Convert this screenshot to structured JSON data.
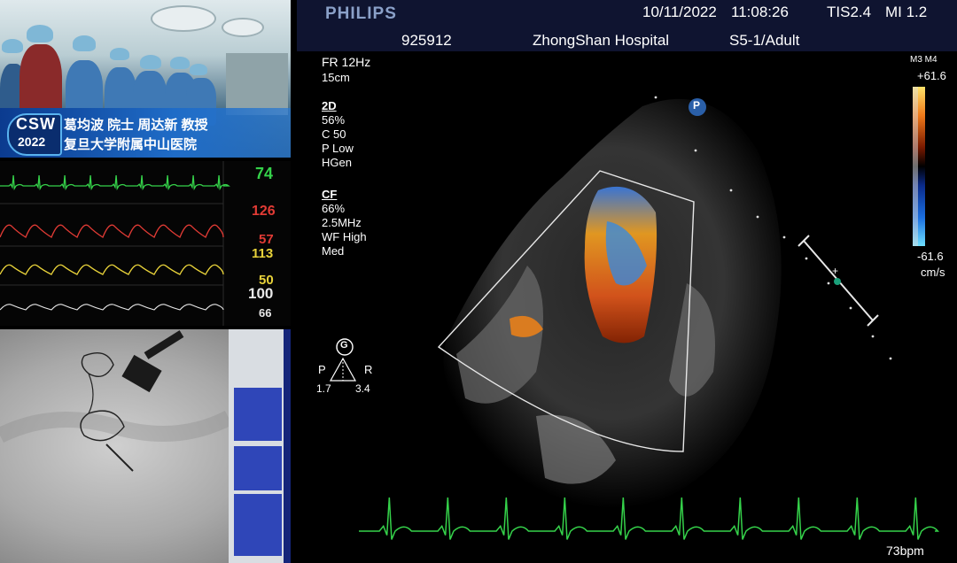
{
  "broadcast": {
    "logo_text": "CSW",
    "logo_year": "2022",
    "speaker_line": "葛均波 院士 周达新 教授",
    "hospital_line": "复旦大学附属中山医院"
  },
  "monitor": {
    "hr": "74",
    "art_sys": "126",
    "art_dia": "57",
    "lv_sys": "113",
    "lv_dia": "50",
    "spo2": "100",
    "resp": "66",
    "colors": {
      "ecg": "#35d24a",
      "art": "#e23b35",
      "lv": "#e8d23a",
      "spo2": "#e8e8e8"
    }
  },
  "echo": {
    "brand": "PHILIPS",
    "date": "10/11/2022",
    "time": "11:08:26",
    "tis": "TIS2.4",
    "mi": "MI 1.2",
    "patient_id": "925912",
    "hospital": "ZhongShan Hospital",
    "probe": "S5-1/Adult",
    "fr": "FR 12Hz",
    "depth": "15cm",
    "mode_2d": "2D",
    "settings_2d": [
      "56%",
      "C 50",
      "P Low",
      "HGen"
    ],
    "mode_cf": "CF",
    "settings_cf": [
      "66%",
      "2.5MHz",
      "WF High",
      "Med"
    ],
    "colorbar_label": "M3 M4",
    "colorbar_top": "+61.6",
    "colorbar_bottom": "-61.6",
    "colorbar_unit": "cm/s",
    "marker_p": "P",
    "marker_g": "G",
    "orient_p": "P",
    "orient_r": "R",
    "orient_left": "1.7",
    "orient_right": "3.4",
    "heart_rate": "73bpm",
    "ecg_color": "#35d24a"
  }
}
